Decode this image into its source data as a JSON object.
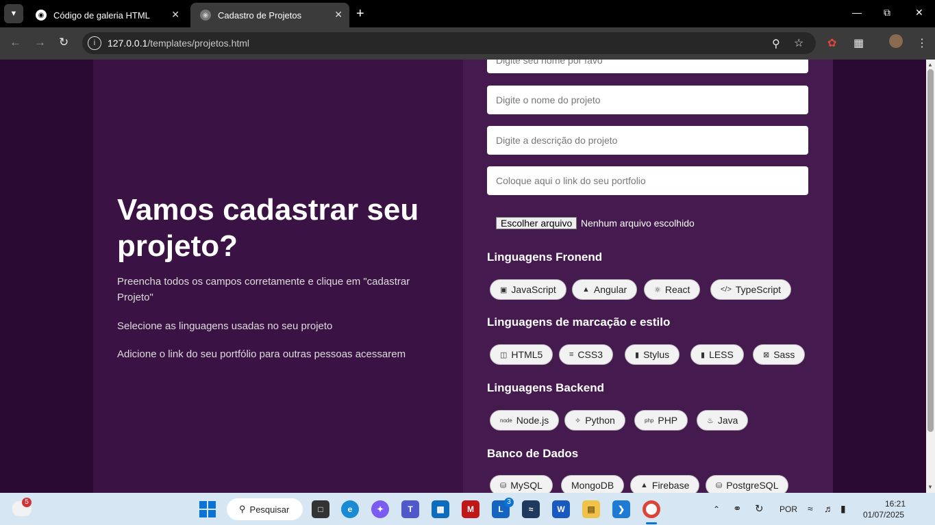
{
  "browser": {
    "tabs": [
      {
        "title": "Código de galeria HTML"
      },
      {
        "title": "Cadastro de Projetos"
      }
    ],
    "url_host": "127.0.0.1",
    "url_path": "/templates/projetos.html"
  },
  "page": {
    "title": "Vamos cadastrar seu projeto?",
    "paragraphs": [
      "Preencha todos os campos corretamente e clique em \"cadastrar Projeto\"",
      "Selecione as linguagens usadas no seu projeto",
      "Adicione o link do seu portfólio para outras pessoas acessarem"
    ],
    "form": {
      "name_placeholder": "Digite seu nome por favo",
      "project_placeholder": "Digite o nome do projeto",
      "description_placeholder": "Digite a descrição do projeto",
      "portfolio_placeholder": "Coloque aqui o link do seu portfolio",
      "file_button": "Escolher arquivo",
      "file_status": "Nenhum arquivo escolhido"
    },
    "sections": [
      {
        "heading": "Linguagens Fronend",
        "items": [
          "JavaScript",
          "Angular",
          "React",
          "TypeScript"
        ]
      },
      {
        "heading": "Linguagens de marcação e estilo",
        "items": [
          "HTML5",
          "CSS3",
          "Stylus",
          "LESS",
          "Sass"
        ]
      },
      {
        "heading": "Linguagens Backend",
        "items": [
          "Node.js",
          "Python",
          "PHP",
          "Java"
        ]
      },
      {
        "heading": "Banco de Dados",
        "items": [
          "MySQL",
          "MongoDB",
          "Firebase",
          "PostgreSQL"
        ]
      }
    ]
  },
  "taskbar": {
    "search_label": "Pesquisar",
    "weather_badge": "5",
    "outlook_badge": "3",
    "language": "POR",
    "time": "16:21",
    "date": "01/07/2025"
  },
  "colors": {
    "page_bg": "#2a0a33",
    "left_card": "#3a1244",
    "right_card": "#451a4f"
  }
}
